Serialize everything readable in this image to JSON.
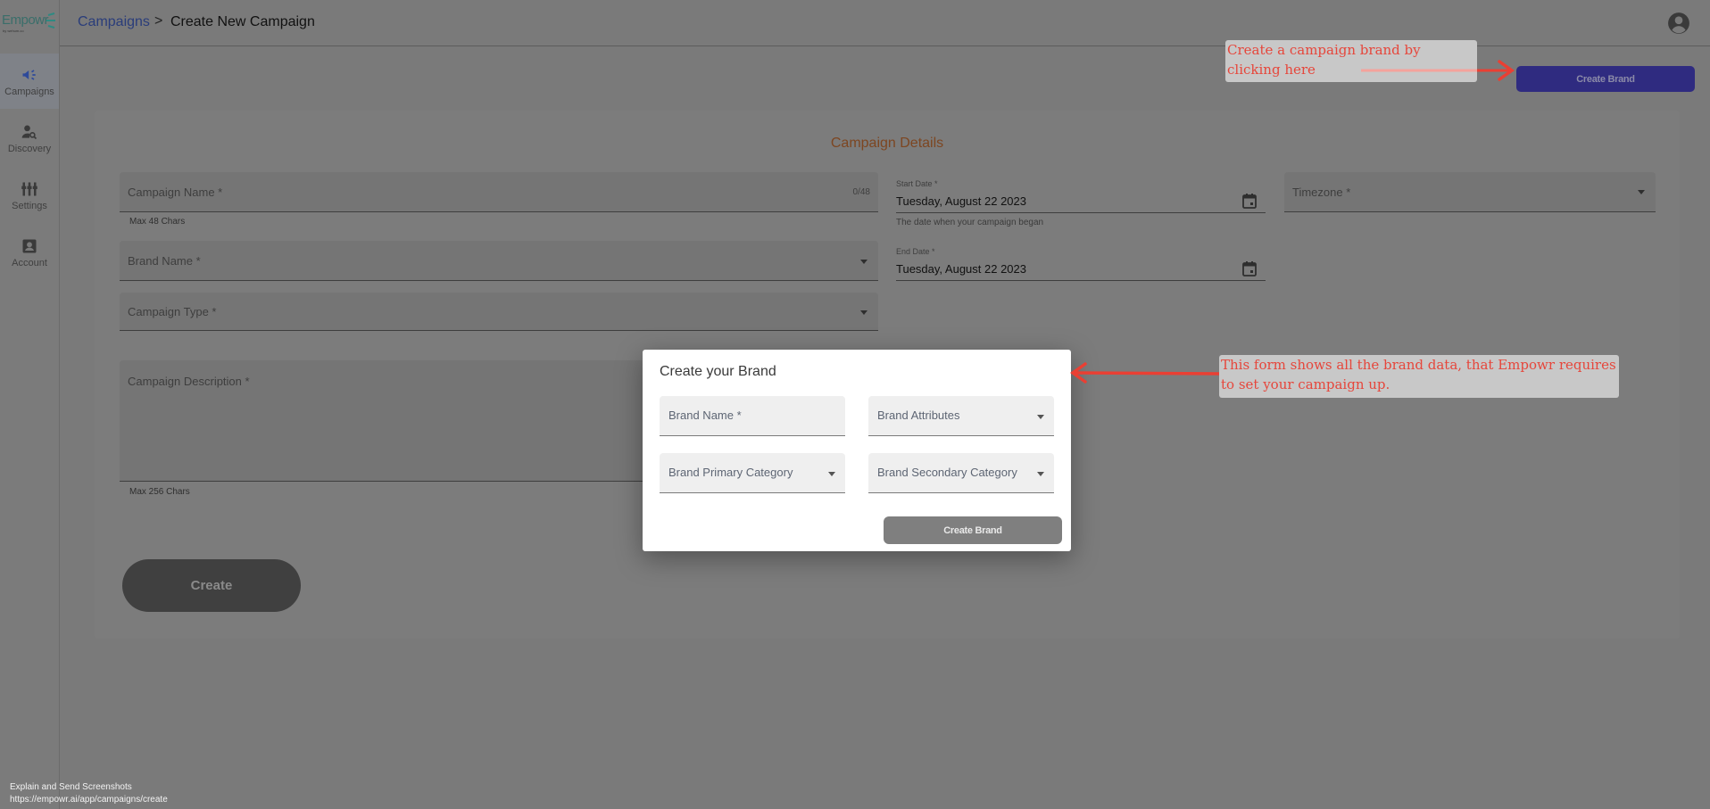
{
  "app": {
    "logo_text": "Empowr",
    "logo_sub": "by wehum.co"
  },
  "sidebar": {
    "items": [
      {
        "label": "Campaigns",
        "icon": "megaphone-icon",
        "active": true
      },
      {
        "label": "Discovery",
        "icon": "person-search-icon",
        "active": false
      },
      {
        "label": "Settings",
        "icon": "sliders-icon",
        "active": false
      },
      {
        "label": "Account",
        "icon": "account-box-icon",
        "active": false
      }
    ]
  },
  "header": {
    "breadcrumb": {
      "parent": "Campaigns",
      "separator": ">",
      "current": "Create New Campaign"
    },
    "account_icon": "account-circle-icon"
  },
  "toolbar": {
    "create_brand_label": "Create Brand"
  },
  "form": {
    "title": "Campaign Details",
    "campaign_name": {
      "label": "Campaign Name *",
      "value": "",
      "counter": "0/48",
      "helper": "Max 48 Chars"
    },
    "start_date": {
      "label": "Start Date *",
      "value": "Tuesday, August 22 2023",
      "helper": "The date when your campaign began"
    },
    "timezone": {
      "label": "Timezone *",
      "value": ""
    },
    "brand_name": {
      "label": "Brand Name *",
      "value": ""
    },
    "end_date": {
      "label": "End Date *",
      "value": "Tuesday, August 22 2023"
    },
    "campaign_type": {
      "label": "Campaign Type *",
      "value": ""
    },
    "description": {
      "label": "Campaign Description *",
      "value": "",
      "helper": "Max 256 Chars"
    },
    "create_label": "Create"
  },
  "modal": {
    "title": "Create your Brand",
    "fields": {
      "brand_name": "Brand Name *",
      "brand_attributes": "Brand Attributes",
      "primary_category": "Brand Primary Category",
      "secondary_category": "Brand Secondary Category"
    },
    "create_label": "Create Brand"
  },
  "annotations": {
    "top": "Create a campaign brand by clicking here",
    "middle": "This form shows all the brand data, that Empowr requires to set your campaign up.",
    "color": "#e6463b"
  },
  "footer": {
    "title": "Explain and Send Screenshots",
    "url": "https://empowr.ai/app/campaigns/create"
  }
}
